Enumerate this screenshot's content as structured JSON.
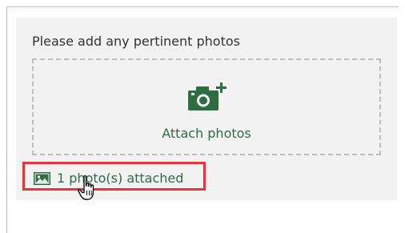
{
  "form": {
    "prompt": "Please add any pertinent photos",
    "dropzone_label": "Attach photos",
    "attached_status": "1 photo(s) attached"
  },
  "icons": {
    "camera": "camera-add-icon",
    "image": "image-icon",
    "cursor": "hand-pointer-cursor"
  },
  "colors": {
    "accent_green": "#2f6b43",
    "highlight_red": "#e8353a",
    "dropzone_border": "#bdbdbd",
    "card_background": "#f2f2f2"
  }
}
